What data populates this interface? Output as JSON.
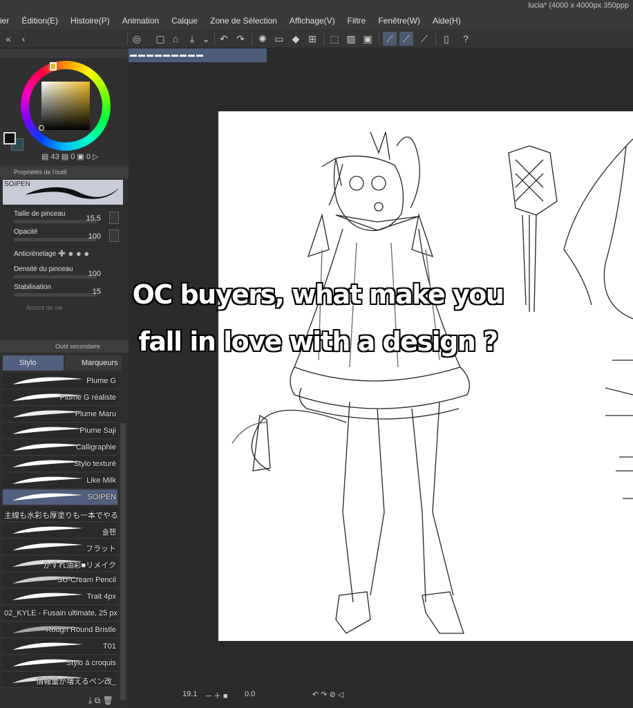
{
  "window": {
    "title": "lucia* (4000 x 4000px 350ppp"
  },
  "menu": [
    "ier",
    "Édition(E)",
    "Histoire(P)",
    "Animation",
    "Calque",
    "Zone de Sélection",
    "Affichage(V)",
    "Filtre",
    "Fenêtre(W)",
    "Aide(H)"
  ],
  "color_panel": {
    "hue_color": "#e8b820",
    "main_color": "#111111",
    "sub_color": "#2c4b55",
    "value_a": "43",
    "value_b": "0",
    "value_c": "0"
  },
  "tool_property": {
    "header": "Propriétés de l'outil",
    "brush_name": "SOIPEN",
    "size_label": "Taille de pinceau",
    "size_value": "15.5",
    "opacity_label": "Opacité",
    "opacity_value": "100",
    "antialias_label": "Anticrénelage",
    "density_label": "Densité du pinceau",
    "density_value": "100",
    "stabilization_label": "Stabilisation",
    "stabilization_value": "15",
    "extra_label": "Amont de vie"
  },
  "subtool": {
    "header": "Outil secondaire",
    "tab_pen": "Stylo",
    "tab_marker": "Marqueurs",
    "brushes": [
      {
        "label": "Plume G"
      },
      {
        "label": "Plume G réaliste"
      },
      {
        "label": "Plume Maru"
      },
      {
        "label": "Plume Saji"
      },
      {
        "label": "Calligraphie"
      },
      {
        "label": "Stylo texturé"
      },
      {
        "label": "Like Milk"
      },
      {
        "label": "SOIPEN",
        "selected": true
      },
      {
        "label": "主線も水彩も厚塗りも一本でやる",
        "left": true
      },
      {
        "label": "솔펜"
      },
      {
        "label": "フラット"
      },
      {
        "label": "かすれ油彩■リメイク"
      },
      {
        "label": "SU-Cream Pencil"
      },
      {
        "label": "Trait 4px"
      },
      {
        "label": "02_KYLE - Fusain ultimate, 25 px",
        "left": true
      },
      {
        "label": "Rough Round Bristle"
      },
      {
        "label": "T01"
      },
      {
        "label": "Stylo à croquis"
      },
      {
        "label": "情報量が増えるペン改_"
      }
    ]
  },
  "document_tab": {
    "name": "▬▬▬▬▬▬▬▬▬"
  },
  "caption": {
    "line1": "OC buyers, what make you",
    "line2": "fall in love with a design ?"
  },
  "status": {
    "zoom": "19.1",
    "rotation": "0.0"
  }
}
